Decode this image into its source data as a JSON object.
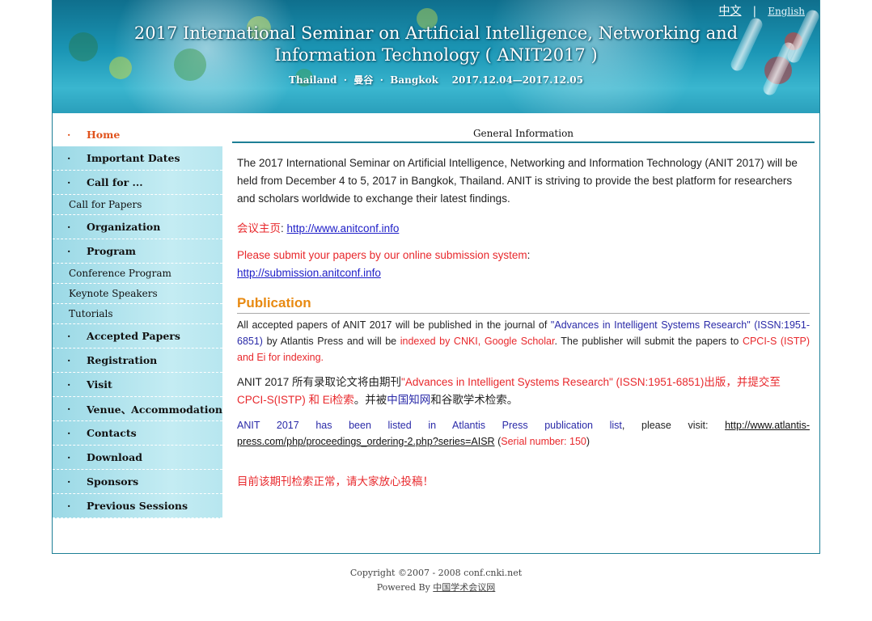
{
  "header": {
    "title_line1": "2017 International Seminar on Artificial Intelligence, Networking and",
    "title_line2": "Information Technology ( ANIT2017 )",
    "subtitle": "Thailand  ·  曼谷  ·  Bangkok    2017.12.04—2017.12.05",
    "lang_cn": "中文",
    "lang_sep": "|",
    "lang_en": "English"
  },
  "sidebar": {
    "items": [
      {
        "label": "Home",
        "type": "main",
        "active": true
      },
      {
        "label": "Important Dates",
        "type": "main"
      },
      {
        "label": "Call for ...",
        "type": "main"
      },
      {
        "label": "Call for Papers",
        "type": "sub"
      },
      {
        "label": "Organization",
        "type": "main"
      },
      {
        "label": "Program",
        "type": "main"
      },
      {
        "label": "Conference Program",
        "type": "sub"
      },
      {
        "label": "Keynote Speakers",
        "type": "sub"
      },
      {
        "label": "Tutorials",
        "type": "sub"
      },
      {
        "label": "Accepted Papers",
        "type": "main"
      },
      {
        "label": "Registration",
        "type": "main"
      },
      {
        "label": "Visit",
        "type": "main"
      },
      {
        "label": "Venue、Accommodation",
        "type": "main"
      },
      {
        "label": "Contacts",
        "type": "main"
      },
      {
        "label": "Download",
        "type": "main"
      },
      {
        "label": "Sponsors",
        "type": "main"
      },
      {
        "label": "Previous Sessions",
        "type": "main"
      }
    ],
    "bullet": "·"
  },
  "main": {
    "section_title": "General Information",
    "intro": "The 2017 International Seminar on Artificial Intelligence, Networking and Information Technology (ANIT 2017) will be held from December 4 to 5, 2017 in Bangkok, Thailand. ANIT is striving to provide the best platform for researchers and scholars worldwide to exchange their latest findings.",
    "homepage_label": "会议主页",
    "homepage_colon": ": ",
    "homepage_url": "http://www.anitconf.info",
    "submit_text": "Please submit your papers by our online submission system",
    "submit_colon": ":",
    "submit_url": "http://submission.anitconf.info",
    "publication_title": "Publication",
    "pub_p1": "All accepted papers of ANIT 2017 will be published in the journal of ",
    "pub_p2": "\"Advances in Intelligent Systems Research\" (ISSN:1951-6851)",
    "pub_p3": " by Atlantis Press and will be ",
    "pub_p4": "indexed by CNKI, Google Scholar",
    "pub_p5": ". The publisher will submit the papers to ",
    "pub_p6": "CPCI-S (ISTP) and Ei for indexing.",
    "cn_p1": "ANIT 2017 所有录取论文将由期刊",
    "cn_p2": "\"Advances in Intelligent Systems Research\" (ISSN:1951-6851)出版，并提交至CPCI-S(ISTP) 和 Ei检索",
    "cn_p3": "。并被",
    "cn_p4": "中国知网",
    "cn_p5": "和谷歌学术检索。",
    "list_p1": "ANIT 2017 has been listed in Atlantis Press publication list",
    "list_p2": ", please visit: ",
    "list_url": "http://www.atlantis-press.com/php/proceedings_ordering-2.php?series=AISR",
    "list_p3": " (",
    "list_p4": "Serial number: 150",
    "list_p5": ")",
    "notice": "目前该期刊检索正常，请大家放心投稿！"
  },
  "footer": {
    "copyright": "Copyright ©2007 - 2008 conf.cnki.net",
    "powered_prefix": "Powered By ",
    "powered_link": "中国学术会议网"
  },
  "colors": {
    "accent": "#1d7f96",
    "active_nav": "#e0531d",
    "publication_heading": "#e88a12",
    "highlight_red": "#e8282c",
    "link_blue": "#2020c8"
  }
}
